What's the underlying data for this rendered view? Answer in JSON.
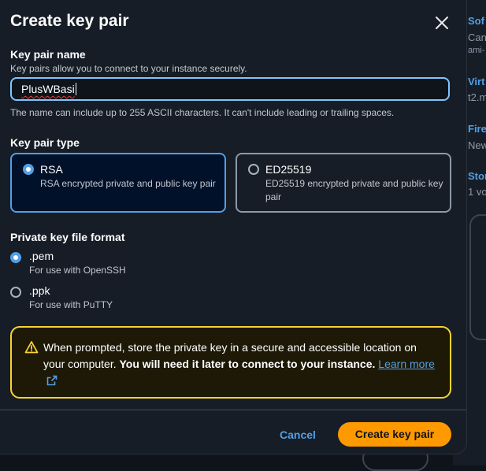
{
  "modal": {
    "title": "Create key pair"
  },
  "key_pair_name": {
    "label": "Key pair name",
    "description": "Key pairs allow you to connect to your instance securely.",
    "value": "PlusWBasi",
    "constraint": "The name can include up to 255 ASCII characters. It can't include leading or trailing spaces."
  },
  "key_pair_type": {
    "label": "Key pair type",
    "options": [
      {
        "label": "RSA",
        "description": "RSA encrypted private and public key pair",
        "selected": true
      },
      {
        "label": "ED25519",
        "description": "ED25519 encrypted private and public key pair",
        "selected": false
      }
    ]
  },
  "file_format": {
    "label": "Private key file format",
    "options": [
      {
        "label": ".pem",
        "description": "For use with OpenSSH",
        "selected": true
      },
      {
        "label": ".ppk",
        "description": "For use with PuTTY",
        "selected": false
      }
    ]
  },
  "alert": {
    "text_before": "When prompted, store the private key in a secure and accessible location on your computer. ",
    "text_bold": "You will need it later to connect to your instance.",
    "link_text": "Learn more",
    "icon": "warning-icon"
  },
  "footer": {
    "cancel_label": "Cancel",
    "submit_label": "Create key pair"
  },
  "background": {
    "items": [
      {
        "title": "Sof",
        "sub": "Can",
        "sub2": "ami-"
      },
      {
        "title": "Virt",
        "sub": "t2.m"
      },
      {
        "title": "Fire",
        "sub": "New"
      },
      {
        "title": "Stor",
        "sub": "1 vo"
      }
    ]
  },
  "colors": {
    "accent": "#539fe5",
    "primary_button": "#ff9900",
    "warning": "#fbd332",
    "surface": "#161d26"
  }
}
